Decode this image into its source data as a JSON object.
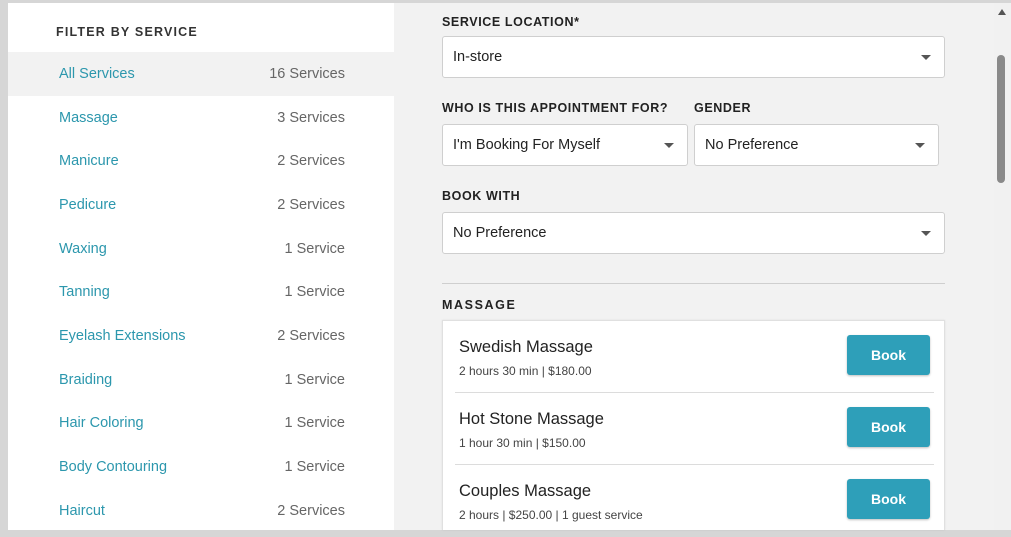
{
  "sidebar": {
    "title": "FILTER BY SERVICE",
    "items": [
      {
        "label": "All Services",
        "count": "16 Services"
      },
      {
        "label": "Massage",
        "count": "3 Services"
      },
      {
        "label": "Manicure",
        "count": "2 Services"
      },
      {
        "label": "Pedicure",
        "count": "2 Services"
      },
      {
        "label": "Waxing",
        "count": "1 Service"
      },
      {
        "label": "Tanning",
        "count": "1 Service"
      },
      {
        "label": "Eyelash Extensions",
        "count": "2 Services"
      },
      {
        "label": "Braiding",
        "count": "1 Service"
      },
      {
        "label": "Hair Coloring",
        "count": "1 Service"
      },
      {
        "label": "Body Contouring",
        "count": "1 Service"
      },
      {
        "label": "Haircut",
        "count": "2 Services"
      }
    ]
  },
  "form": {
    "location_label": "SERVICE LOCATION*",
    "location_value": "In-store",
    "for_label": "WHO IS THIS APPOINTMENT FOR?",
    "for_value": "I'm Booking For Myself",
    "gender_label": "GENDER",
    "gender_value": "No Preference",
    "book_with_label": "BOOK WITH",
    "book_with_value": "No Preference"
  },
  "section": {
    "title": "MASSAGE",
    "services": [
      {
        "name": "Swedish Massage",
        "meta": "2 hours 30 min | $180.00",
        "button": "Book"
      },
      {
        "name": "Hot Stone Massage",
        "meta": "1 hour 30 min | $150.00",
        "button": "Book"
      },
      {
        "name": "Couples Massage",
        "meta": "2 hours | $250.00 | 1 guest service",
        "button": "Book"
      }
    ]
  },
  "colors": {
    "accent": "#2e9fb9",
    "link": "#2c97ad",
    "pane_bg": "#f2f2f2"
  }
}
